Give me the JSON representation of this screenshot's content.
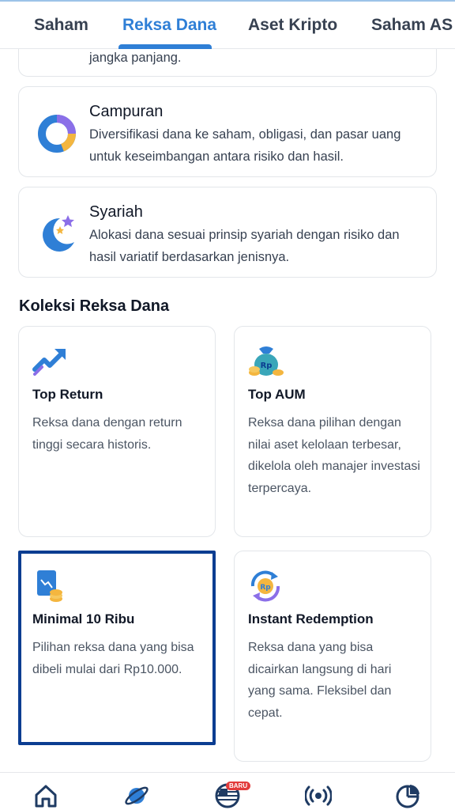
{
  "tabs": [
    {
      "label": "Saham"
    },
    {
      "label": "Reksa Dana"
    },
    {
      "label": "Aset Kripto"
    },
    {
      "label": "Saham AS"
    }
  ],
  "categories": [
    {
      "title": "",
      "description": "jangka panjang."
    },
    {
      "title": "Campuran",
      "description": "Diversifikasi dana ke saham, obligasi, dan pasar uang untuk keseimbangan antara risiko dan hasil.",
      "icon": "donut-chart-icon"
    },
    {
      "title": "Syariah",
      "description": "Alokasi dana sesuai prinsip syariah dengan risiko dan hasil variatif berdasarkan jenisnya.",
      "icon": "crescent-moon-icon"
    }
  ],
  "collection": {
    "title": "Koleksi Reksa Dana",
    "items": [
      {
        "title": "Top Return",
        "description": "Reksa dana dengan return tinggi secara historis.",
        "icon": "trending-up-icon"
      },
      {
        "title": "Top AUM",
        "description": "Reksa dana pilihan dengan nilai aset kelolaan terbesar, dikelola oleh manajer investasi terpercaya.",
        "icon": "money-bag-icon"
      },
      {
        "title": "Minimal 10 Ribu",
        "description": "Pilihan reksa dana yang bisa dibeli mulai dari Rp10.000.",
        "icon": "document-coins-icon"
      },
      {
        "title": "Instant Redemption",
        "description": "Reksa dana yang bisa dicairkan langsung di hari yang sama. Fleksibel dan cepat.",
        "icon": "coin-refresh-icon"
      }
    ]
  },
  "bottom_nav": {
    "badge": "BARU",
    "items": [
      "home-icon",
      "planet-icon",
      "us-flag-icon",
      "broadcast-icon",
      "pie-chart-icon"
    ]
  },
  "colors": {
    "accent": "#2f7fd6",
    "selected_border": "#0b3d91",
    "badge": "#e23b3b"
  }
}
